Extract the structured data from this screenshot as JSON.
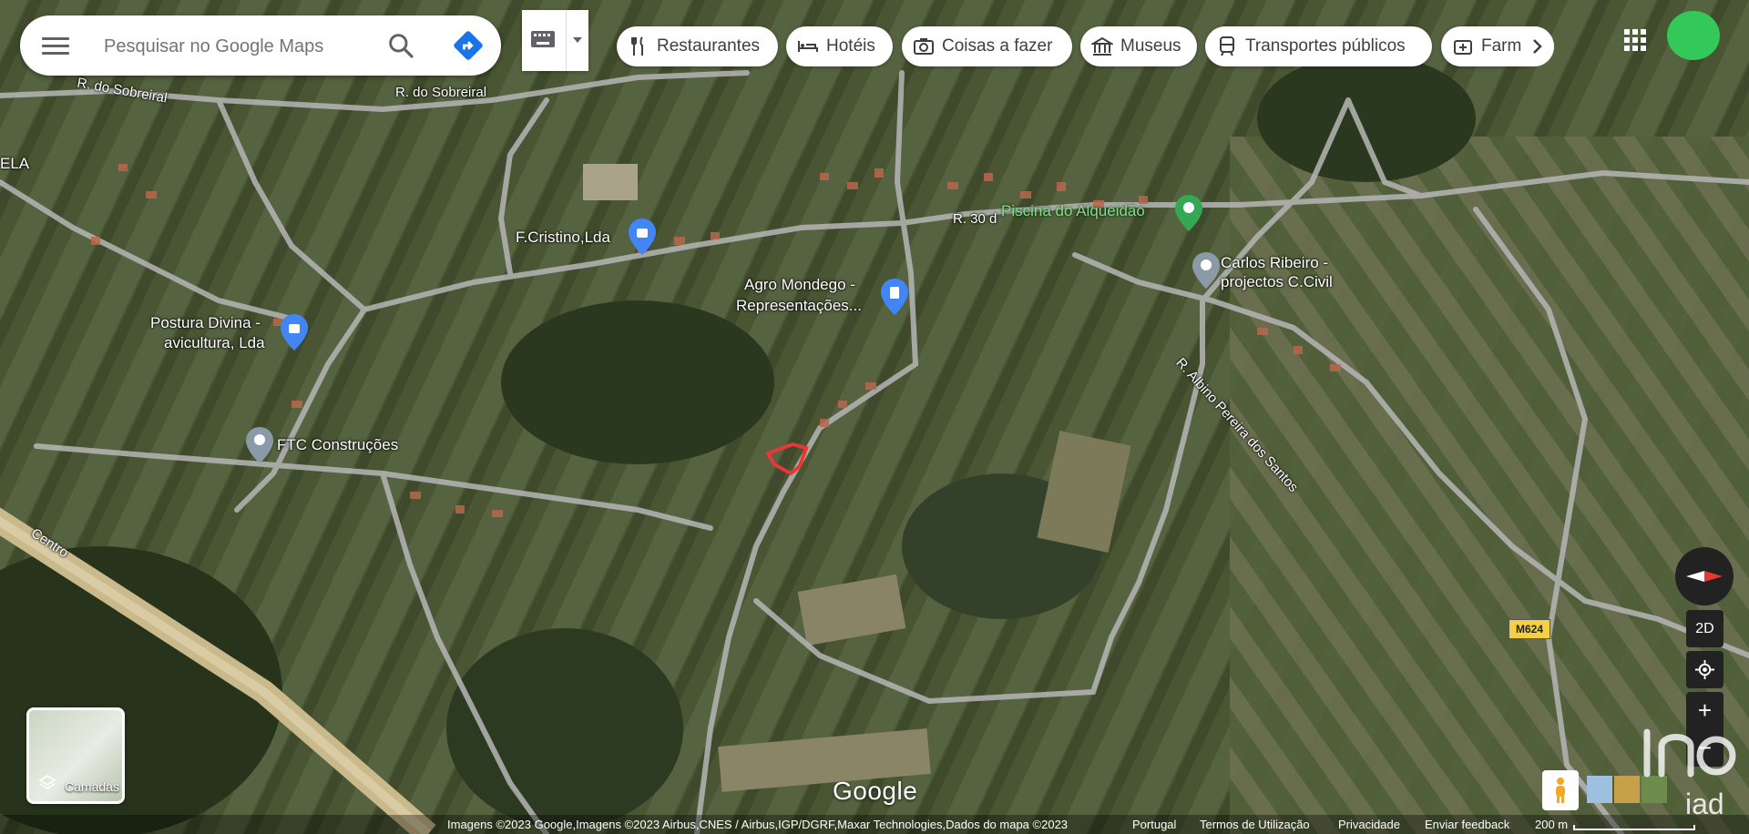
{
  "search": {
    "placeholder": "Pesquisar no Google Maps",
    "menu_icon": "menu-icon",
    "search_icon": "search-icon",
    "directions_icon": "directions-icon"
  },
  "keyboard": {
    "icon": "keyboard-icon",
    "dropdown_icon": "chevron-down-icon"
  },
  "chips": [
    {
      "label": "Restaurantes",
      "icon": "fork-knife-icon"
    },
    {
      "label": "Hotéis",
      "icon": "bed-icon"
    },
    {
      "label": "Coisas a fazer",
      "icon": "camera-icon"
    },
    {
      "label": "Museus",
      "icon": "museum-icon"
    },
    {
      "label": "Transportes públicos",
      "icon": "train-icon"
    },
    {
      "label": "Farmác",
      "icon": "pharmacy-icon"
    }
  ],
  "chip_next_icon": "chevron-right-icon",
  "account": {
    "apps_icon": "apps-grid-icon",
    "avatar_color": "#34c759"
  },
  "map_labels": {
    "ela": "ELA",
    "sobreiral": "R. do Sobreiral",
    "sobreiral2": "R. do Sobreiral",
    "r30": "R. 30 d",
    "piscina": "Piscina do Alqueidão",
    "fcristino": "F.Cristino,Lda",
    "agro1": "Agro Mondego -",
    "agro2": "Representações...",
    "carlos1": "Carlos Ribeiro -",
    "carlos2": "projectos C.Civil",
    "postura1": "Postura Divina -",
    "postura2": "avicultura, Lda",
    "ftc": "FTC Construções",
    "albino": "R. Albino Pereira dos Santos",
    "centro": "Centro",
    "m624": "M624"
  },
  "controls": {
    "layers_label": "Camadas",
    "view_2d": "2D",
    "compass_icon": "compass-icon",
    "location_icon": "my-location-icon",
    "zoom_in": "+",
    "zoom_out": "−",
    "pegman_icon": "pegman-icon"
  },
  "footer": {
    "google": "Google",
    "imagery": "Imagens ©2023 Google,Imagens ©2023 Airbus,CNES / Airbus,IGP/DGRF,Maxar Technologies,Dados do mapa ©2023",
    "country": "Portugal",
    "terms": "Termos de Utilização",
    "privacy": "Privacidade",
    "feedback": "Enviar feedback",
    "scale": "200 m"
  },
  "watermark": "iad",
  "colors": {
    "pin_blue": "#4285f4",
    "pin_green": "#34a853",
    "parcel_red": "#e53935",
    "directions_blue": "#1a73e8"
  }
}
